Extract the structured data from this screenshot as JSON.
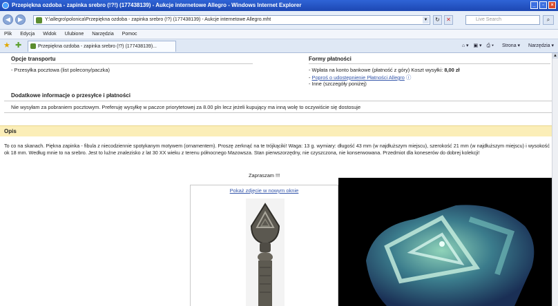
{
  "window": {
    "title": "Przepiękna ozdoba - zapinka srebro (!?!) (177438139) - Aukcje internetowe Allegro - Windows Internet Explorer",
    "min": "_",
    "max": "▫",
    "close": "×"
  },
  "address": {
    "url": "Y:\\allegro\\polonica\\Przepiękna ozdoba - zapinka srebro (!?) (177438139) - Aukcje internetowe Allegro.mht",
    "search_placeholder": "Live Search"
  },
  "menu": [
    "Plik",
    "Edycja",
    "Widok",
    "Ulubione",
    "Narzędzia",
    "Pomoc"
  ],
  "tab": {
    "label": "Przepiękna ozdoba - zapinka srebro (!?) (177438139)..."
  },
  "tabtools": {
    "strona": "Strona",
    "narzedzia": "Narzędzia"
  },
  "transport": {
    "heading": "Opcje transportu",
    "item": "- Przesyłka pocztowa (list polecony/paczka)"
  },
  "payment": {
    "heading": "Formy płatności",
    "item1_prefix": "- Wpłata na konto bankowe (płatność z góry)",
    "item1_cost_label": "Koszt wysyłki:",
    "item1_cost": "8,00 zł",
    "item2_link": "Poproś o udostępnienie Płatności Allegro",
    "item3": "- Inne (szczegóły poniżej)"
  },
  "extra": {
    "heading": "Dodatkowe informacje o przesyłce i płatności",
    "text": "Nie wysyłam za pobraniem pocztowym. Preferuję wysyłkę w paczce priorytetowej za 8.00 pln lecz jeżeli kupujący ma inną wolę to oczywiście się dostosuje"
  },
  "opis": {
    "heading": "Opis",
    "text": "To co na skanach. Piękna zapinka - fibula z niecodziennie spotykanym motywem (ornamentem). Proszę zerknąć na te trójkąciki! Waga: 13 g. wymiary: długość 43 mm (w najdłuższym miejscu), szerokość 21 mm (w najdłuższym miejscu) i wysokość ok 18 mm. Według mnie to na srebro. Jest to luźne znalezisko z lat 30 XX wieku z terenu północnego Mazowsza. Stan pierwszorzędny, nie czyszczona, nie konserwowana. Przedmiot dla koneserów do dobrej kolekcji!",
    "invite": "Zapraszam !!!",
    "photo_link": "Pokaż zdjęcie w nowym oknie"
  }
}
